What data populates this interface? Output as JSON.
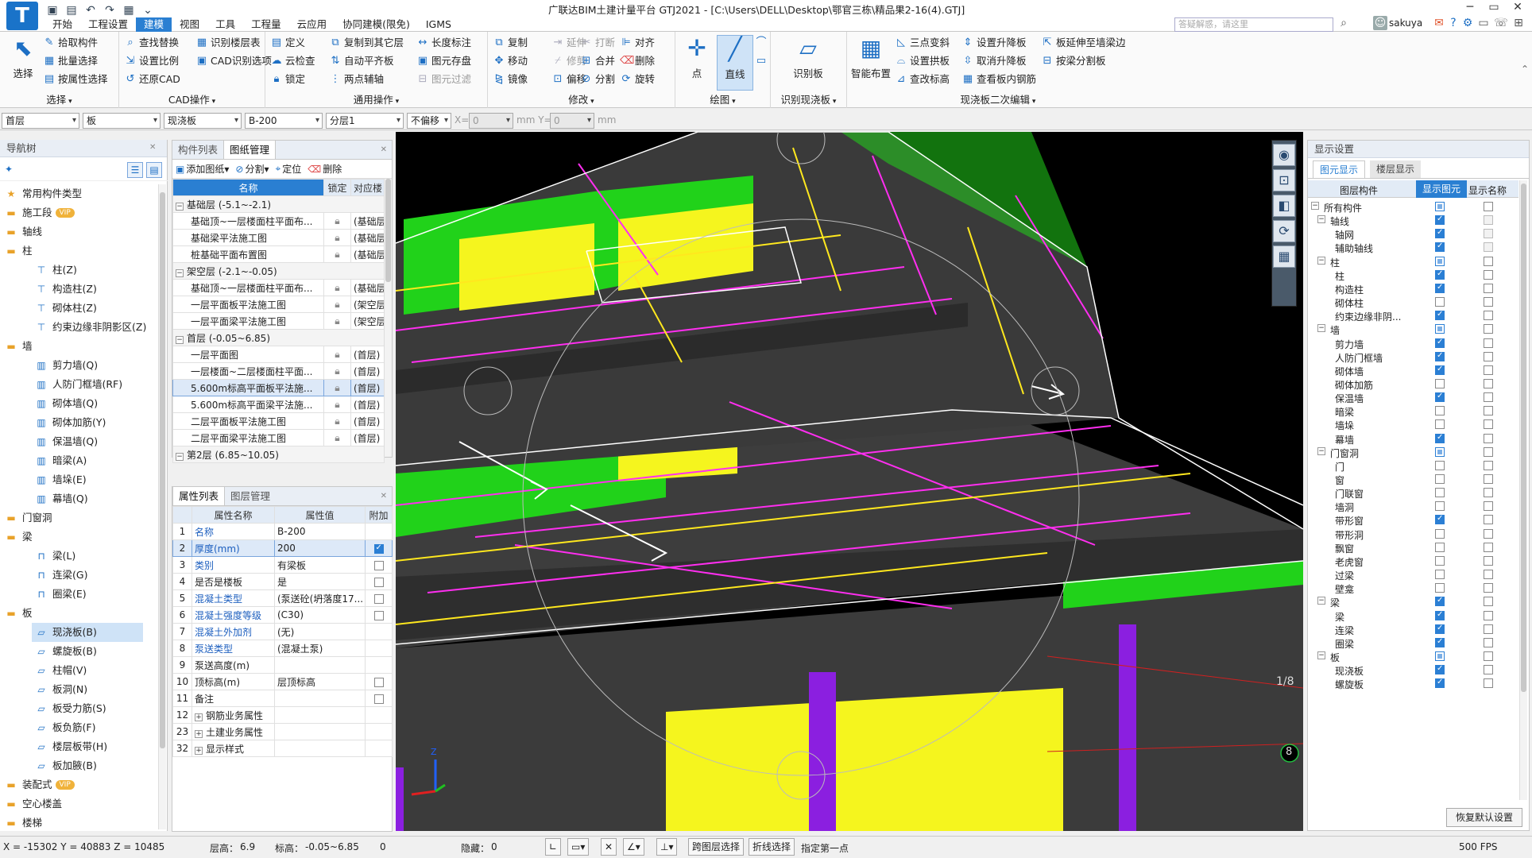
{
  "app": {
    "window_title": "广联达BIM土建计量平台 GTJ2021 - [C:\\Users\\DELL\\Desktop\\鄂官三栋\\精品果2-16(4).GTJ]",
    "logo_letter": "T",
    "username": "sakuya",
    "search_placeholder": "答疑解惑，请这里",
    "tabs": [
      "开始",
      "工程设置",
      "建模",
      "视图",
      "工具",
      "工程量",
      "云应用",
      "协同建模(限免)",
      "IGMS"
    ],
    "active_tab": "建模"
  },
  "ribbon": {
    "select_group": {
      "title": "选择",
      "big_label": "选择",
      "items": [
        "拾取构件",
        "批量选择",
        "按属性选择"
      ]
    },
    "cad_group": {
      "title": "CAD操作",
      "items": [
        "查找替换",
        "识别楼层表",
        "设置比例",
        "CAD识别选项",
        "还原CAD"
      ]
    },
    "common_group": {
      "title": "通用操作",
      "items": [
        "定义",
        "复制到其它层",
        "长度标注",
        "云检查",
        "自动平齐板",
        "图元存盘",
        "锁定",
        "两点辅轴",
        "图元过滤"
      ]
    },
    "modify_group": {
      "title": "修改",
      "items": [
        "复制",
        "延伸",
        "打断",
        "对齐",
        "移动",
        "修剪",
        "合并",
        "删除",
        "镜像",
        "偏移",
        "分割",
        "旋转"
      ]
    },
    "draw_group": {
      "title": "绘图",
      "point_label": "点",
      "line_label": "直线"
    },
    "identify_group": {
      "title": "识别现浇板",
      "label": "识别板"
    },
    "slab_edit_group": {
      "title": "现浇板二次编辑",
      "smart_label": "智能布置",
      "items": [
        "三点变斜",
        "设置升降板",
        "板延伸至墙梁边",
        "设置拱板",
        "取消升降板",
        "按梁分割板",
        "查改标高",
        "查看板内钢筋"
      ]
    }
  },
  "toolbar2": {
    "floor": "首层",
    "category": "板",
    "type": "现浇板",
    "component": "B-200",
    "layer": "分层1",
    "offset_mode": "不偏移",
    "x_label": "X=",
    "x_value": "0",
    "mm_y_label": "mm Y=",
    "y_value": "0",
    "mm_label": "mm"
  },
  "nav": {
    "title": "导航树",
    "items": [
      {
        "label": "常用构件类型",
        "kind": "cat",
        "icon": "star-folder"
      },
      {
        "label": "施工段",
        "kind": "cat",
        "icon": "folder",
        "vip": "VIP"
      },
      {
        "label": "轴线",
        "kind": "cat",
        "icon": "folder"
      },
      {
        "label": "柱",
        "kind": "cat",
        "icon": "folder"
      },
      {
        "label": "柱(Z)",
        "kind": "sub",
        "icon": "column"
      },
      {
        "label": "构造柱(Z)",
        "kind": "sub",
        "icon": "column"
      },
      {
        "label": "砌体柱(Z)",
        "kind": "sub",
        "icon": "column"
      },
      {
        "label": "约束边缘非阴影区(Z)",
        "kind": "sub",
        "icon": "column"
      },
      {
        "label": "墙",
        "kind": "cat",
        "icon": "folder"
      },
      {
        "label": "剪力墙(Q)",
        "kind": "sub",
        "icon": "wall"
      },
      {
        "label": "人防门框墙(RF)",
        "kind": "sub",
        "icon": "wall"
      },
      {
        "label": "砌体墙(Q)",
        "kind": "sub",
        "icon": "wall"
      },
      {
        "label": "砌体加筋(Y)",
        "kind": "sub",
        "icon": "wall"
      },
      {
        "label": "保温墙(Q)",
        "kind": "sub",
        "icon": "wall"
      },
      {
        "label": "暗梁(A)",
        "kind": "sub",
        "icon": "wall"
      },
      {
        "label": "墙垛(E)",
        "kind": "sub",
        "icon": "wall"
      },
      {
        "label": "幕墙(Q)",
        "kind": "sub",
        "icon": "wall"
      },
      {
        "label": "门窗洞",
        "kind": "cat",
        "icon": "folder"
      },
      {
        "label": "梁",
        "kind": "cat",
        "icon": "folder"
      },
      {
        "label": "梁(L)",
        "kind": "sub",
        "icon": "beam"
      },
      {
        "label": "连梁(G)",
        "kind": "sub",
        "icon": "beam"
      },
      {
        "label": "圈梁(E)",
        "kind": "sub",
        "icon": "beam"
      },
      {
        "label": "板",
        "kind": "cat",
        "icon": "folder"
      },
      {
        "label": "现浇板(B)",
        "kind": "sub",
        "icon": "slab",
        "selected": true
      },
      {
        "label": "螺旋板(B)",
        "kind": "sub",
        "icon": "slab"
      },
      {
        "label": "柱帽(V)",
        "kind": "sub",
        "icon": "slab"
      },
      {
        "label": "板洞(N)",
        "kind": "sub",
        "icon": "slab"
      },
      {
        "label": "板受力筋(S)",
        "kind": "sub",
        "icon": "slab"
      },
      {
        "label": "板负筋(F)",
        "kind": "sub",
        "icon": "slab"
      },
      {
        "label": "楼层板带(H)",
        "kind": "sub",
        "icon": "slab"
      },
      {
        "label": "板加腋(B)",
        "kind": "sub",
        "icon": "slab"
      },
      {
        "label": "装配式",
        "kind": "cat",
        "icon": "folder",
        "vip": "VIP"
      },
      {
        "label": "空心楼盖",
        "kind": "cat",
        "icon": "folder"
      },
      {
        "label": "楼梯",
        "kind": "cat",
        "icon": "folder"
      }
    ]
  },
  "drawing_panel": {
    "tabs": [
      "构件列表",
      "图纸管理"
    ],
    "active_tab": "图纸管理",
    "toolbar": [
      "添加图纸",
      "分割",
      "定位",
      "删除"
    ],
    "columns": [
      "名称",
      "锁定",
      "对应楼"
    ],
    "rows": [
      {
        "group": true,
        "name": "基础层 (-5.1~-2.1)"
      },
      {
        "name": "基础顶~一层楼面柱平面布...",
        "floor": "(基础层"
      },
      {
        "name": "基础梁平法施工图",
        "floor": "(基础层"
      },
      {
        "name": "桩基础平面布置图",
        "floor": "(基础层"
      },
      {
        "group": true,
        "name": "架空层 (-2.1~-0.05)"
      },
      {
        "name": "基础顶~一层楼面柱平面布...",
        "floor": "(基础层"
      },
      {
        "name": "一层平面板平法施工图",
        "floor": "(架空层"
      },
      {
        "name": "一层平面梁平法施工图",
        "floor": "(架空层"
      },
      {
        "group": true,
        "name": "首层 (-0.05~6.85)"
      },
      {
        "name": "一层平面图",
        "floor": "(首层)"
      },
      {
        "name": "一层楼面~二层楼面柱平面...",
        "floor": "(首层)"
      },
      {
        "name": "5.600m标高平面板平法施...",
        "floor": "(首层)",
        "selected": true
      },
      {
        "name": "5.600m标高平面梁平法施...",
        "floor": "(首层)"
      },
      {
        "name": "二层平面板平法施工图",
        "floor": "(首层)"
      },
      {
        "name": "二层平面梁平法施工图",
        "floor": "(首层)"
      },
      {
        "group": true,
        "name": "第2层 (6.85~10.05)"
      }
    ]
  },
  "property_panel": {
    "tabs": [
      "属性列表",
      "图层管理"
    ],
    "active_tab": "属性列表",
    "columns": [
      "属性名称",
      "属性值",
      "附加"
    ],
    "rows": [
      {
        "no": "1",
        "name": "名称",
        "value": "B-200",
        "blue": true,
        "check": null
      },
      {
        "no": "2",
        "name": "厚度(mm)",
        "value": "200",
        "blue": true,
        "check": "on",
        "selected": true
      },
      {
        "no": "3",
        "name": "类别",
        "value": "有梁板",
        "blue": true,
        "check": "off"
      },
      {
        "no": "4",
        "name": "是否是楼板",
        "value": "是",
        "blue": false,
        "check": "off"
      },
      {
        "no": "5",
        "name": "混凝土类型",
        "value": "(泵送砼(坍落度17...",
        "blue": true,
        "check": "off"
      },
      {
        "no": "6",
        "name": "混凝土强度等级",
        "value": "(C30)",
        "blue": true,
        "check": "off"
      },
      {
        "no": "7",
        "name": "混凝土外加剂",
        "value": "(无)",
        "blue": true,
        "check": null
      },
      {
        "no": "8",
        "name": "泵送类型",
        "value": "(混凝土泵)",
        "blue": true,
        "check": null
      },
      {
        "no": "9",
        "name": "泵送高度(m)",
        "value": "",
        "blue": false,
        "check": null
      },
      {
        "no": "10",
        "name": "顶标高(m)",
        "value": "层顶标高",
        "blue": false,
        "check": "off"
      },
      {
        "no": "11",
        "name": "备注",
        "value": "",
        "blue": false,
        "check": "off"
      },
      {
        "no": "12",
        "name": "钢筋业务属性",
        "value": "",
        "blue": false,
        "expand": true,
        "check": null
      },
      {
        "no": "23",
        "name": "土建业务属性",
        "value": "",
        "blue": false,
        "expand": true,
        "check": null
      },
      {
        "no": "32",
        "name": "显示样式",
        "value": "",
        "blue": false,
        "expand": true,
        "check": null
      }
    ]
  },
  "display_panel": {
    "title": "显示设置",
    "tabs": [
      "图元显示",
      "楼层显示"
    ],
    "active_tab": "图元显示",
    "columns": [
      "图层构件",
      "显示图元",
      "显示名称"
    ],
    "rows": [
      {
        "label": "所有构件",
        "level": 0,
        "toggle": "-",
        "show": "part",
        "name": "off"
      },
      {
        "label": "轴线",
        "level": 1,
        "toggle": "-",
        "show": "on",
        "name": "dis"
      },
      {
        "label": "轴网",
        "level": 2,
        "show": "on",
        "name": "dis"
      },
      {
        "label": "辅助轴线",
        "level": 2,
        "show": "on",
        "name": "dis"
      },
      {
        "label": "柱",
        "level": 1,
        "toggle": "-",
        "show": "part",
        "name": "off"
      },
      {
        "label": "柱",
        "level": 2,
        "show": "on",
        "name": "off"
      },
      {
        "label": "构造柱",
        "level": 2,
        "show": "on",
        "name": "off"
      },
      {
        "label": "砌体柱",
        "level": 2,
        "show": "off",
        "name": "off"
      },
      {
        "label": "约束边缘非阴...",
        "level": 2,
        "show": "on",
        "name": "off"
      },
      {
        "label": "墙",
        "level": 1,
        "toggle": "-",
        "show": "part",
        "name": "off"
      },
      {
        "label": "剪力墙",
        "level": 2,
        "show": "on",
        "name": "off"
      },
      {
        "label": "人防门框墙",
        "level": 2,
        "show": "on",
        "name": "off"
      },
      {
        "label": "砌体墙",
        "level": 2,
        "show": "on",
        "name": "off"
      },
      {
        "label": "砌体加筋",
        "level": 2,
        "show": "off",
        "name": "off"
      },
      {
        "label": "保温墙",
        "level": 2,
        "show": "on",
        "name": "off"
      },
      {
        "label": "暗梁",
        "level": 2,
        "show": "off",
        "name": "off"
      },
      {
        "label": "墙垛",
        "level": 2,
        "show": "off",
        "name": "off"
      },
      {
        "label": "幕墙",
        "level": 2,
        "show": "on",
        "name": "off"
      },
      {
        "label": "门窗洞",
        "level": 1,
        "toggle": "-",
        "show": "part",
        "name": "off"
      },
      {
        "label": "门",
        "level": 2,
        "show": "off",
        "name": "off"
      },
      {
        "label": "窗",
        "level": 2,
        "show": "off",
        "name": "off"
      },
      {
        "label": "门联窗",
        "level": 2,
        "show": "off",
        "name": "off"
      },
      {
        "label": "墙洞",
        "level": 2,
        "show": "off",
        "name": "off"
      },
      {
        "label": "带形窗",
        "level": 2,
        "show": "on",
        "name": "off"
      },
      {
        "label": "带形洞",
        "level": 2,
        "show": "off",
        "name": "off"
      },
      {
        "label": "飘窗",
        "level": 2,
        "show": "off",
        "name": "off"
      },
      {
        "label": "老虎窗",
        "level": 2,
        "show": "off",
        "name": "off"
      },
      {
        "label": "过梁",
        "level": 2,
        "show": "off",
        "name": "off"
      },
      {
        "label": "壁龛",
        "level": 2,
        "show": "off",
        "name": "off"
      },
      {
        "label": "梁",
        "level": 1,
        "toggle": "-",
        "show": "on",
        "name": "off"
      },
      {
        "label": "梁",
        "level": 2,
        "show": "on",
        "name": "off"
      },
      {
        "label": "连梁",
        "level": 2,
        "show": "on",
        "name": "off"
      },
      {
        "label": "圈梁",
        "level": 2,
        "show": "on",
        "name": "off"
      },
      {
        "label": "板",
        "level": 1,
        "toggle": "-",
        "show": "part",
        "name": "off"
      },
      {
        "label": "现浇板",
        "level": 2,
        "show": "on",
        "name": "off"
      },
      {
        "label": "螺旋板",
        "level": 2,
        "show": "on",
        "name": "off"
      }
    ],
    "restore_label": "恢复默认设置"
  },
  "viewport": {
    "axis_label_1": "1/8",
    "axis_label_2": "8",
    "z_axis": "Z"
  },
  "status": {
    "coords": "X = -15302 Y = 40883 Z = 10485",
    "floor_height_label": "层高：",
    "floor_height": "6.9",
    "elevation_label": "标高：",
    "elevation": "-0.05~6.85",
    "zero": "0",
    "hidden_label": "隐藏：",
    "hidden": "0",
    "cross_floor": "跨图层选择",
    "polyline_select": "折线选择",
    "hint": "指定第一点",
    "fps": "500 FPS"
  },
  "colors": {
    "accent": "#2a7fd2",
    "slab": "#3a3a3a",
    "wall_green": "#21d21a",
    "wall_yellow": "#f5f51e",
    "column_purple": "#8b1fe0",
    "rebar_magenta": "#ff2ef0",
    "rebar_yellow": "#ffe81e"
  }
}
